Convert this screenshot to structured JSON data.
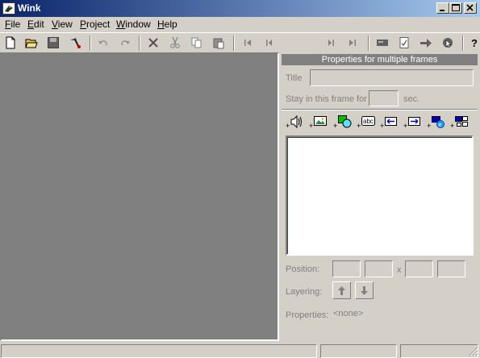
{
  "window": {
    "title": "Wink"
  },
  "menu": [
    {
      "key": "F",
      "rest": "ile"
    },
    {
      "key": "E",
      "rest": "dit"
    },
    {
      "key": "V",
      "rest": "iew"
    },
    {
      "key": "P",
      "rest": "roject"
    },
    {
      "key": "W",
      "rest": "indow"
    },
    {
      "key": "H",
      "rest": "elp"
    }
  ],
  "toolbar": {
    "icons": [
      "new-icon",
      "open-icon",
      "save-icon",
      "render-icon",
      "undo-icon",
      "redo-icon",
      "delete-icon",
      "cut-icon",
      "copy-icon",
      "paste-icon",
      "first-frame-icon",
      "prev-frame-icon",
      "next-frame-icon",
      "last-frame-icon",
      "screen-icon",
      "checklist-icon",
      "arrow-right-icon",
      "cursor-icon",
      "help-icon"
    ]
  },
  "properties": {
    "header": "Properties for multiple frames",
    "title_label": "Title",
    "title_value": "",
    "stay_label": "Stay in this frame for",
    "stay_value": "",
    "stay_unit": "sec.",
    "add_icons": [
      "add-audio-icon",
      "add-image-icon",
      "add-shape-icon",
      "add-text-icon",
      "add-button-back-icon",
      "add-button-next-icon",
      "add-button-url-icon",
      "add-button-frame-icon"
    ],
    "position_label": "Position:",
    "position_sep": "x",
    "layering_label": "Layering:",
    "properties_label": "Properties:",
    "properties_value": "<none>"
  },
  "status": {
    "pane1": "",
    "pane2": "",
    "pane3": ""
  }
}
